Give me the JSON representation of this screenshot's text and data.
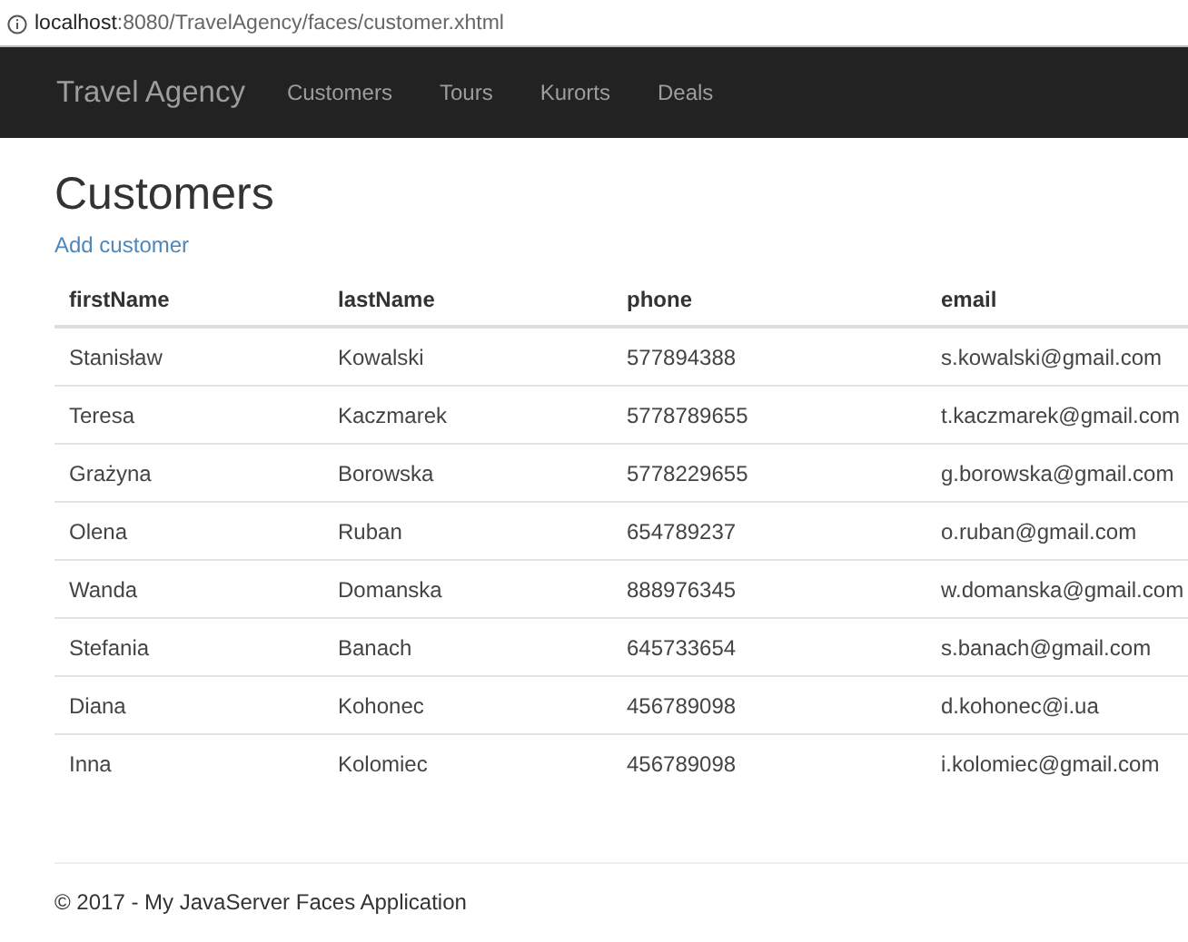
{
  "address_bar": {
    "url": "**localhost**:8080/TravelAgency/faces/customer.xhtml"
  },
  "navbar": {
    "brand": "Travel Agency",
    "links": [
      "Customers",
      "Tours",
      "Kurorts",
      "Deals"
    ]
  },
  "page": {
    "title": "Customers",
    "add_link": "Add customer"
  },
  "table": {
    "columns": [
      "firstName",
      "lastName",
      "phone",
      "email"
    ],
    "rows": [
      [
        "Stanisław",
        "Kowalski",
        "577894388",
        "s.kowalski@gmail.com"
      ],
      [
        "Teresa",
        "Kaczmarek",
        "5778789655",
        "t.kaczmarek@gmail.com"
      ],
      [
        "Grażyna",
        "Borowska",
        "5778229655",
        "g.borowska@gmail.com"
      ],
      [
        "Olena",
        "Ruban",
        "654789237",
        "o.ruban@gmail.com"
      ],
      [
        "Wanda",
        "Domanska",
        "888976345",
        "w.domanska@gmail.com"
      ],
      [
        "Stefania",
        "Banach",
        "645733654",
        "s.banach@gmail.com"
      ],
      [
        "Diana",
        "Kohonec",
        "456789098",
        "d.kohonec@i.ua"
      ],
      [
        "Inna",
        "Kolomiec",
        "456789098",
        "i.kolomiec@gmail.com"
      ]
    ]
  },
  "footer": "© 2017 - My JavaServer Faces Application"
}
